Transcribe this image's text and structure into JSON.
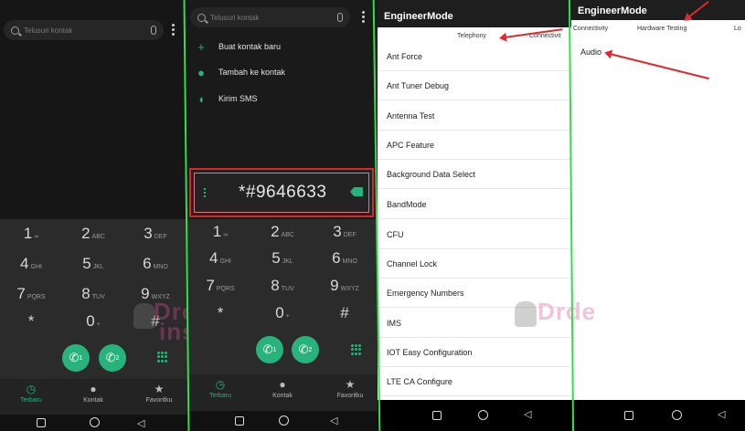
{
  "panel1": {
    "search_placeholder": "Telusuri kontak",
    "keys": [
      {
        "digit": "1",
        "letters": "∞"
      },
      {
        "digit": "2",
        "letters": "ABC"
      },
      {
        "digit": "3",
        "letters": "DEF"
      },
      {
        "digit": "4",
        "letters": "GHI"
      },
      {
        "digit": "5",
        "letters": "JKL"
      },
      {
        "digit": "6",
        "letters": "MNO"
      },
      {
        "digit": "7",
        "letters": "PQRS"
      },
      {
        "digit": "8",
        "letters": "TUV"
      },
      {
        "digit": "9",
        "letters": "WXYZ"
      },
      {
        "digit": "*",
        "letters": ""
      },
      {
        "digit": "0",
        "letters": "+"
      },
      {
        "digit": "#",
        "letters": ""
      }
    ],
    "sim1": "1",
    "sim2": "2",
    "tabs": [
      "Terbaru",
      "Kontak",
      "Favoritku"
    ]
  },
  "panel2": {
    "search_placeholder": "Telusuri kontak",
    "menu": [
      "Buat kontak baru",
      "Tambah ke kontak",
      "Kirim SMS"
    ],
    "dialed_number": "*#9646633",
    "keys": [
      {
        "digit": "1",
        "letters": "∞"
      },
      {
        "digit": "2",
        "letters": "ABC"
      },
      {
        "digit": "3",
        "letters": "DEF"
      },
      {
        "digit": "4",
        "letters": "GHI"
      },
      {
        "digit": "5",
        "letters": "JKL"
      },
      {
        "digit": "6",
        "letters": "MNO"
      },
      {
        "digit": "7",
        "letters": "PQRS"
      },
      {
        "digit": "8",
        "letters": "TUV"
      },
      {
        "digit": "9",
        "letters": "WXYZ"
      },
      {
        "digit": "*",
        "letters": ""
      },
      {
        "digit": "0",
        "letters": "+"
      },
      {
        "digit": "#",
        "letters": ""
      }
    ],
    "sim1": "1",
    "sim2": "2",
    "tabs": [
      "Terbaru",
      "Kontak",
      "Favoritku"
    ]
  },
  "panel3": {
    "title": "EngineerMode",
    "tabs": [
      "Telephony",
      "Connectivit"
    ],
    "items": [
      "Ant Force",
      "Ant Tuner Debug",
      "Antenna Test",
      "APC Feature",
      "Background Data Select",
      "BandMode",
      "CFU",
      "Channel Lock",
      "Emergency Numbers",
      "IMS",
      "IOT Easy Configuration",
      "LTE CA Configure"
    ]
  },
  "panel4": {
    "title": "EngineerMode",
    "tabs": [
      "Connectivity",
      "Hardware Testing",
      "Lo"
    ],
    "items": [
      "Audio"
    ]
  },
  "watermark": {
    "line1": "Droid",
    "line2": "inside"
  },
  "colors": {
    "accent": "#28b37c",
    "highlight": "#d9252c",
    "marker": "#2ee04a"
  }
}
